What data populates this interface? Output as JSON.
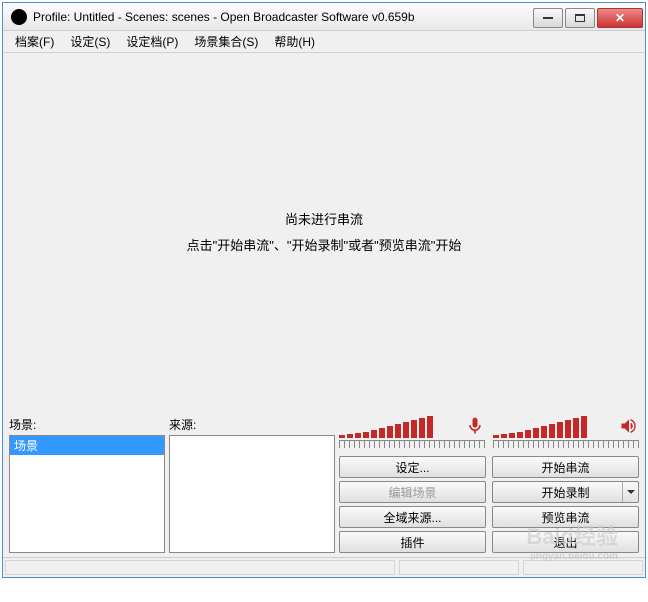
{
  "title": "Profile: Untitled - Scenes: scenes - Open Broadcaster Software v0.659b",
  "menu": {
    "file": "档案(F)",
    "settings": "设定(S)",
    "profile": "设定档(P)",
    "sceneCollection": "场景集合(S)",
    "help": "帮助(H)"
  },
  "preview": {
    "line1": "尚未进行串流",
    "line2": "点击\"开始串流\"、\"开始录制\"或者\"预览串流\"开始"
  },
  "panels": {
    "scenesLabel": "场景:",
    "sourcesLabel": "来源:",
    "sceneItems": [
      "场景"
    ]
  },
  "buttons": {
    "settings": "设定...",
    "startStream": "开始串流",
    "editScene": "编辑场景",
    "startRecord": "开始录制",
    "globalSources": "全域来源...",
    "previewStream": "预览串流",
    "plugins": "插件",
    "exit": "退出"
  },
  "watermark": {
    "main": "Baid经验",
    "sub": "jingyan.baidu.com"
  }
}
